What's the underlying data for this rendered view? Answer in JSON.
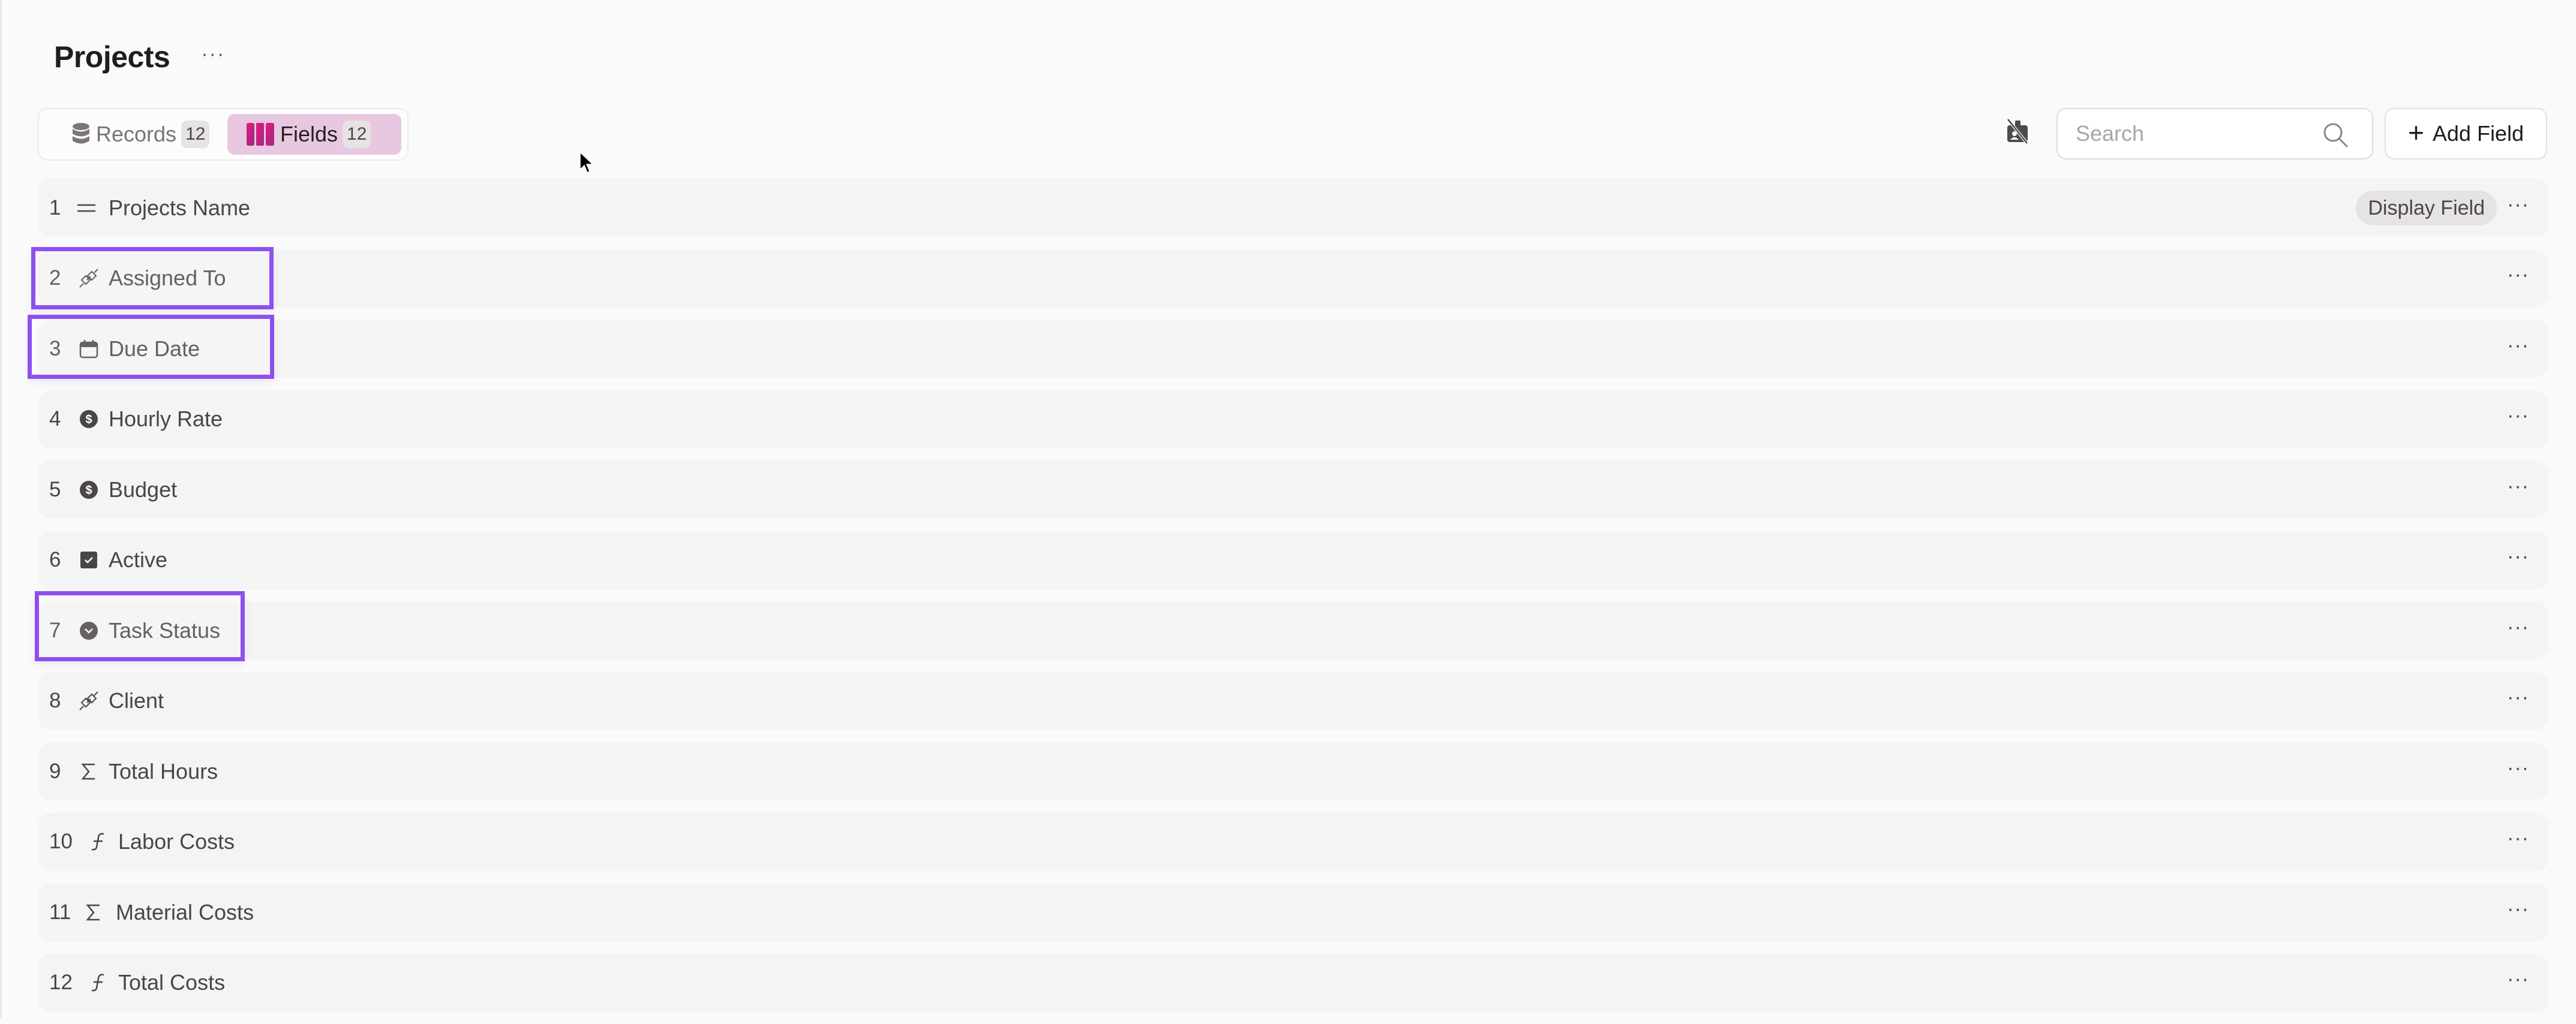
{
  "header": {
    "title": "Projects",
    "more_label": "···"
  },
  "tabs": [
    {
      "label": "Records",
      "count": "12",
      "icon": "database-icon",
      "active": false
    },
    {
      "label": "Fields",
      "count": "12",
      "icon": "columns-icon",
      "active": true
    }
  ],
  "toolbar": {
    "hidden_fields_icon": "hidden-fields-icon",
    "search_placeholder": "Search",
    "search_value": "",
    "add_field_label": "Add Field",
    "add_field_icon": "+"
  },
  "fields": [
    {
      "index": "1",
      "name": "Projects Name",
      "type": "text",
      "icon": "text-lines-icon",
      "badge": "Display Field",
      "highlighted": false
    },
    {
      "index": "2",
      "name": "Assigned To",
      "type": "link",
      "icon": "link-plug-icon",
      "highlighted": true
    },
    {
      "index": "3",
      "name": "Due Date",
      "type": "date",
      "icon": "calendar-icon",
      "highlighted": true
    },
    {
      "index": "4",
      "name": "Hourly Rate",
      "type": "currency",
      "icon": "dollar-circle-icon",
      "highlighted": false
    },
    {
      "index": "5",
      "name": "Budget",
      "type": "currency",
      "icon": "dollar-circle-icon",
      "highlighted": false
    },
    {
      "index": "6",
      "name": "Active",
      "type": "checkbox",
      "icon": "checkbox-icon",
      "highlighted": false
    },
    {
      "index": "7",
      "name": "Task Status",
      "type": "single-select",
      "icon": "chevron-circle-icon",
      "highlighted": true
    },
    {
      "index": "8",
      "name": "Client",
      "type": "link",
      "icon": "link-plug-icon",
      "highlighted": false
    },
    {
      "index": "9",
      "name": "Total Hours",
      "type": "rollup",
      "icon": "sigma-icon",
      "highlighted": false
    },
    {
      "index": "10",
      "name": "Labor Costs",
      "type": "formula",
      "icon": "function-icon",
      "highlighted": false
    },
    {
      "index": "11",
      "name": "Material Costs",
      "type": "rollup",
      "icon": "sigma-icon",
      "highlighted": false
    },
    {
      "index": "12",
      "name": "Total Costs",
      "type": "formula",
      "icon": "function-icon",
      "highlighted": false
    }
  ],
  "row_more_label": "···",
  "colors": {
    "accent_highlight": "#8f4ff0",
    "fields_tab_bg": "#e8c8e0",
    "fields_icon": "#d81b74"
  }
}
